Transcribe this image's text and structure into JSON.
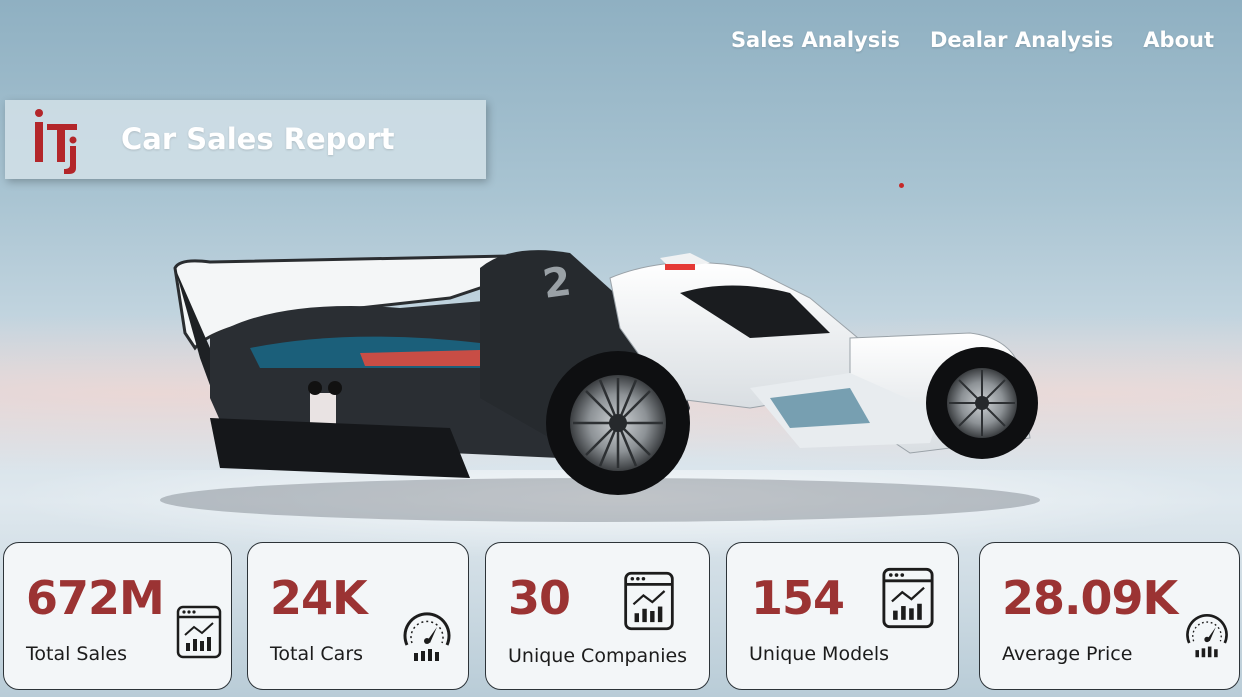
{
  "nav": {
    "items": [
      "Sales Analysis",
      "Dealar Analysis",
      "About"
    ]
  },
  "header": {
    "title": "Car Sales Report",
    "logo_text": "iti"
  },
  "colors": {
    "accent": "#9b3333",
    "logo": "#b3262a",
    "card_bg": "#f3f6f8"
  },
  "hero": {
    "car_number": "2"
  },
  "kpis": [
    {
      "value": "672M",
      "label": "Total Sales",
      "icon": "chart-icon"
    },
    {
      "value": "24K",
      "label": "Total Cars",
      "icon": "speedometer-icon"
    },
    {
      "value": "30",
      "label": "Unique Companies",
      "icon": "chart-icon"
    },
    {
      "value": "154",
      "label": "Unique Models",
      "icon": "chart-icon"
    },
    {
      "value": "28.09K",
      "label": "Average Price",
      "icon": "speedometer-icon"
    }
  ]
}
